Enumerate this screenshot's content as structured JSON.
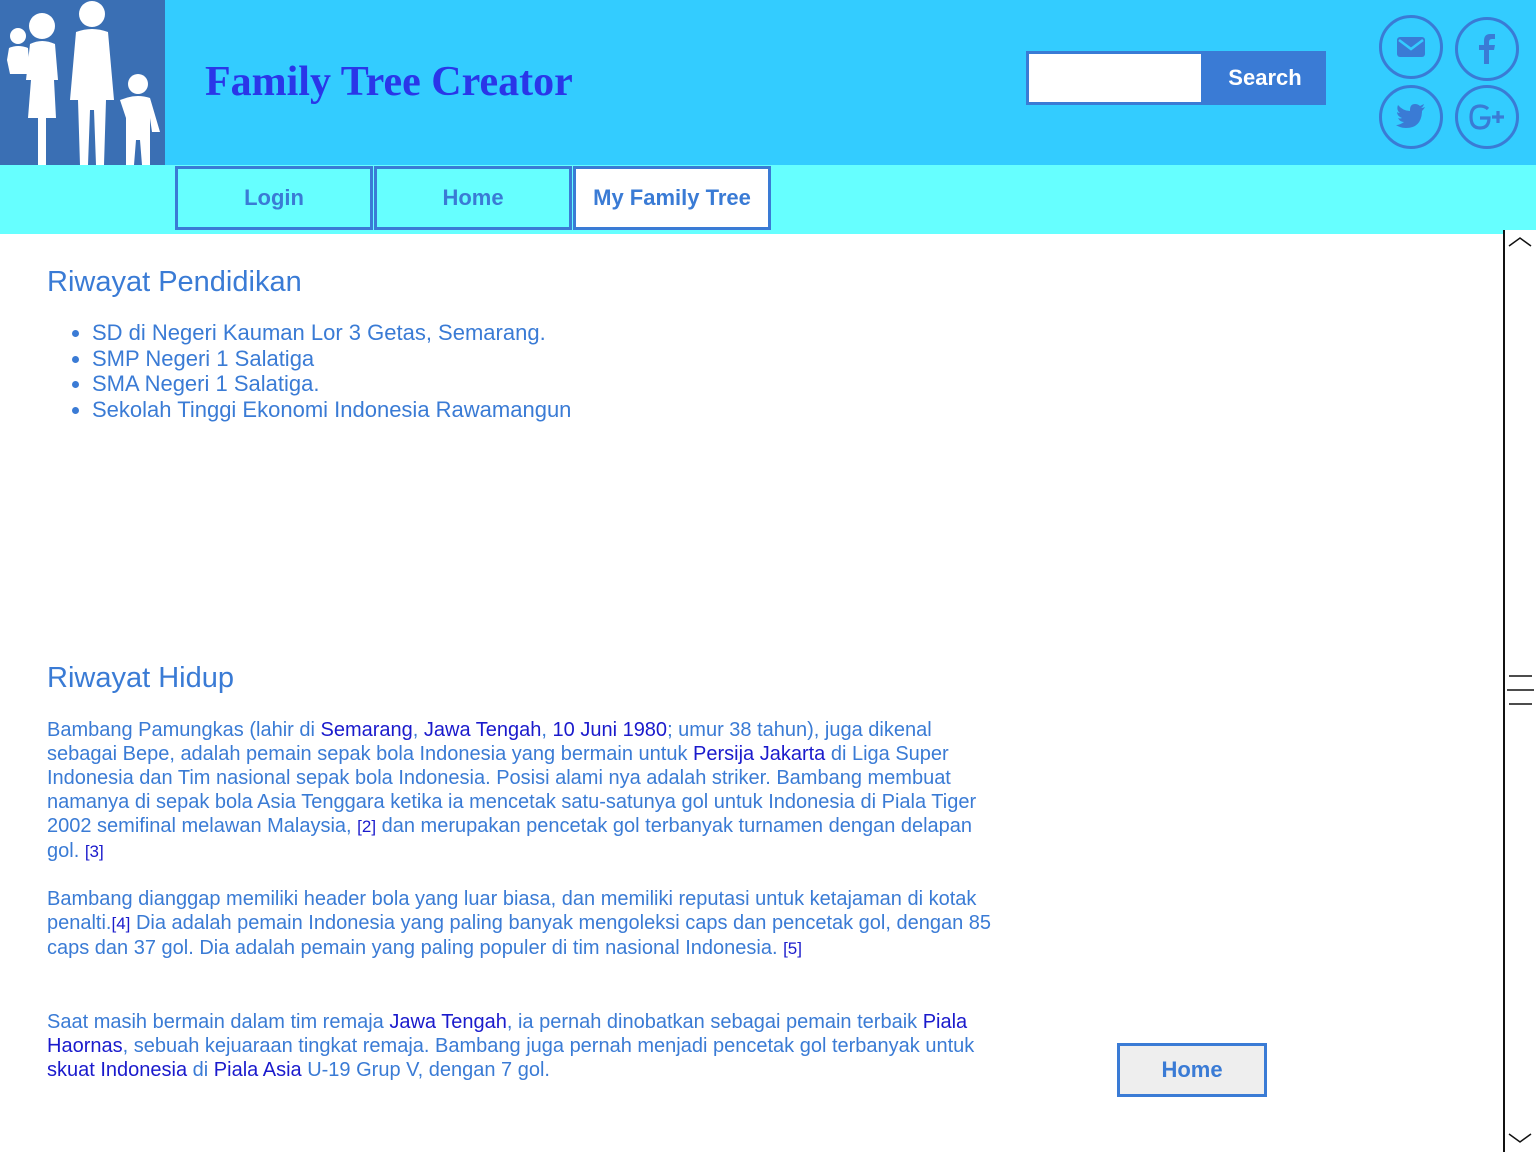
{
  "header": {
    "logo_icon": "family-silhouette-icon",
    "title": "Family Tree Creator",
    "search": {
      "value": "",
      "placeholder": "",
      "button_label": "Search"
    },
    "social_icons": [
      "email-icon",
      "facebook-icon",
      "twitter-icon",
      "google-plus-icon"
    ]
  },
  "nav": {
    "items": [
      {
        "label": "Login"
      },
      {
        "label": "Home"
      },
      {
        "label": "My Family Tree"
      }
    ],
    "active": "My Family Tree"
  },
  "education": {
    "title": "Riwayat Pendidikan",
    "items": [
      "SD di Negeri Kauman Lor 3 Getas, Semarang.",
      "SMP Negeri 1 Salatiga",
      "SMA Negeri 1 Salatiga.",
      "Sekolah Tinggi Ekonomi Indonesia Rawamangun"
    ]
  },
  "biography": {
    "title": "Riwayat Hidup",
    "p1": {
      "t1": "Bambang Pamungkas  (lahir di ",
      "l1": "Semarang",
      "t2": ", ",
      "l2": "Jawa Tengah",
      "t3": ", ",
      "l3": "10 Juni 1980",
      "t4": "; umur 38 tahun), juga dikenal sebagai Bepe, adalah pemain sepak bola Indonesia yang bermain untuk   ",
      "l4": "Persija Jakarta",
      "t5": " di Liga Super Indonesia dan Tim nasional sepak bola Indonesia. Posisi alami nya adalah striker. Bambang membuat namanya di sepak bola Asia Tenggara ketika ia mencetak satu-satunya gol untuk Indonesia di Piala Tiger 2002 semifinal melawan Malaysia, ",
      "r1": "[2]",
      "t6": " dan merupakan pencetak gol terbanyak turnamen dengan delapan gol. ",
      "r2": "[3]"
    },
    "p2": {
      "t1": "Bambang dianggap memiliki header bola yang luar biasa, dan memiliki reputasi untuk ketajaman di kotak penalti.",
      "r1": "[4]",
      "t2": " Dia adalah pemain Indonesia yang paling banyak mengoleksi caps dan pencetak gol, dengan 85 caps dan 37 gol. Dia adalah pemain yang paling populer di tim nasional Indonesia.   ",
      "r2": "[5]"
    },
    "p3": {
      "t1": "Saat masih bermain dalam tim remaja  ",
      "l1": "Jawa Tengah",
      "t2": ", ia pernah dinobatkan sebagai pemain terbaik ",
      "l2": "Piala Haornas",
      "t3": ", sebuah kejuaraan tingkat remaja. Bambang juga pernah menjadi pencetak gol terbanyak untuk ",
      "l3": "skuat Indonesia",
      "t4": " di ",
      "l4": "Piala Asia",
      "t5": " U-19 Grup V, dengan 7 gol."
    }
  },
  "footer_button": {
    "label": "Home"
  },
  "colors": {
    "header_bg": "#33ccff",
    "nav_bg": "#66ffff",
    "accent": "#3a7bd5",
    "logo_bg": "#3a6fb4",
    "title": "#2a36e8",
    "link": "#1a1acc"
  }
}
